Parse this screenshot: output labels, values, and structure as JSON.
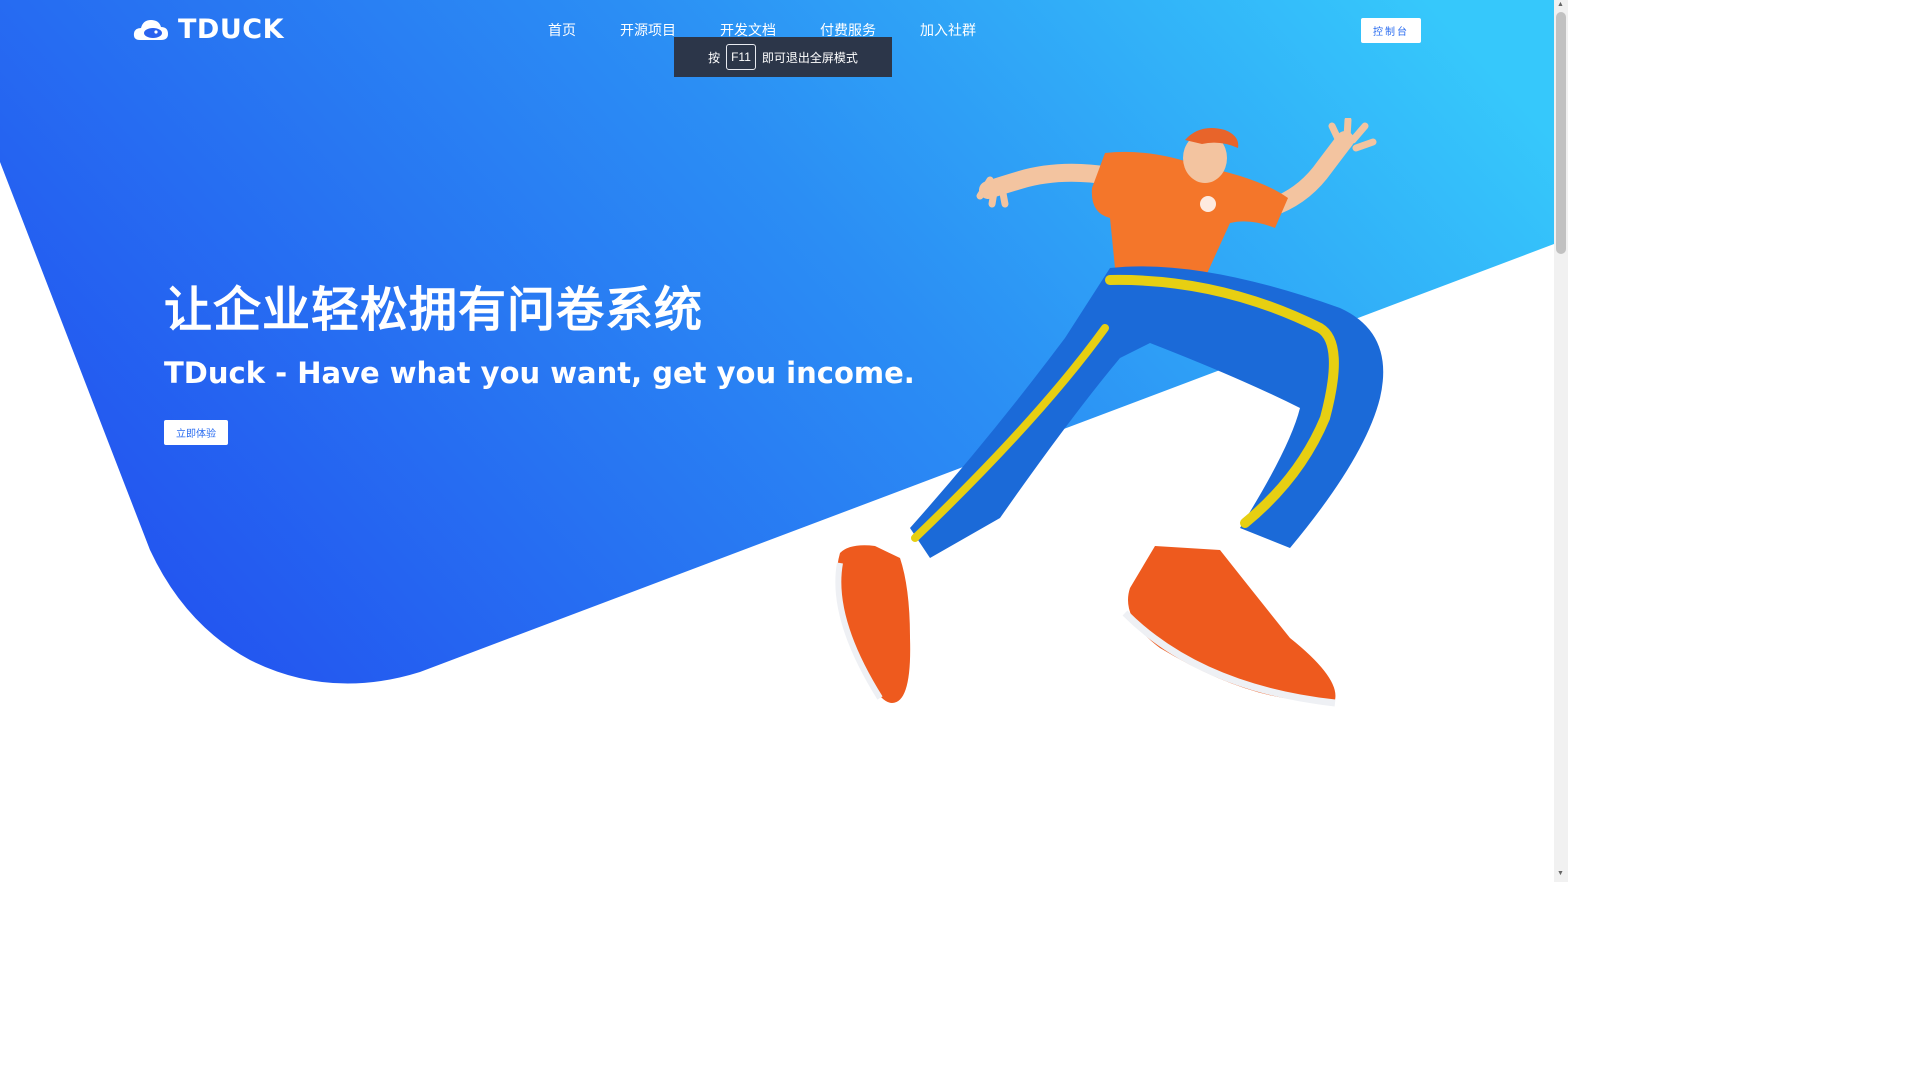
{
  "brand": {
    "name": "TDUCK"
  },
  "nav": {
    "items": [
      {
        "label": "首页"
      },
      {
        "label": "开源项目"
      },
      {
        "label": "开发文档"
      },
      {
        "label": "付费服务"
      },
      {
        "label": "加入社群"
      }
    ],
    "console_label": "控制台"
  },
  "fullscreen_toast": {
    "prefix": "按",
    "key": "F11",
    "suffix": "即可退出全屏模式"
  },
  "hero": {
    "title": "让企业轻松拥有问卷系统",
    "subtitle": "TDuck - Have what you want, get you income.",
    "cta_label": "立即体验"
  },
  "colors": {
    "gradient_start": "#2356f0",
    "gradient_end": "#36c8fb",
    "accent": "#2a6cf0",
    "toast_bg": "#2c3649"
  },
  "icons": {
    "logo": "cloud-duck-icon",
    "illustration": "running-man-illustration"
  }
}
